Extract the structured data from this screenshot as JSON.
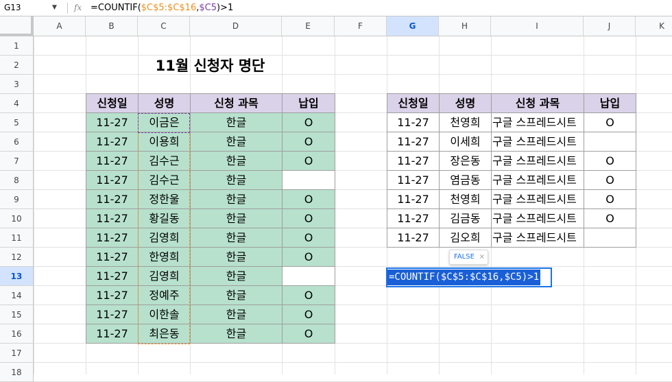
{
  "formula_bar": {
    "cell_ref": "G13",
    "fx_label": "fx",
    "formula_tokens": [
      {
        "text": "=COUNTIF(",
        "kind": "plain"
      },
      {
        "text": "$C$5:$C$16",
        "kind": "range"
      },
      {
        "text": ",",
        "kind": "plain"
      },
      {
        "text": "$C5",
        "kind": "ref"
      },
      {
        "text": ")>1",
        "kind": "plain"
      }
    ]
  },
  "grid": {
    "columns": [
      "A",
      "B",
      "C",
      "D",
      "E",
      "F",
      "G",
      "H",
      "I",
      "J",
      "K"
    ],
    "rows": [
      "1",
      "2",
      "3",
      "4",
      "5",
      "6",
      "7",
      "8",
      "9",
      "10",
      "11",
      "12",
      "13",
      "14",
      "15",
      "16",
      "17",
      "18"
    ],
    "selected_column": "G",
    "selected_row": "13"
  },
  "title": "11월 신청자 명단",
  "left_table": {
    "headers": [
      "신청일",
      "성명",
      "신청 과목",
      "납입"
    ],
    "rows": [
      [
        "11-27",
        "이금은",
        "한글",
        "O"
      ],
      [
        "11-27",
        "이용희",
        "한글",
        "O"
      ],
      [
        "11-27",
        "김수근",
        "한글",
        "O"
      ],
      [
        "11-27",
        "김수근",
        "한글",
        ""
      ],
      [
        "11-27",
        "정한울",
        "한글",
        "O"
      ],
      [
        "11-27",
        "황길동",
        "한글",
        "O"
      ],
      [
        "11-27",
        "김영희",
        "한글",
        "O"
      ],
      [
        "11-27",
        "한영희",
        "한글",
        "O"
      ],
      [
        "11-27",
        "김영희",
        "한글",
        ""
      ],
      [
        "11-27",
        "정예주",
        "한글",
        "O"
      ],
      [
        "11-27",
        "이한솔",
        "한글",
        "O"
      ],
      [
        "11-27",
        "최은동",
        "한글",
        "O"
      ]
    ]
  },
  "right_table": {
    "headers": [
      "신청일",
      "성명",
      "신청 과목",
      "납입"
    ],
    "rows": [
      [
        "11-27",
        "천영희",
        "구글 스프레드시트",
        "O"
      ],
      [
        "11-27",
        "이세희",
        "구글 스프레드시트",
        ""
      ],
      [
        "11-27",
        "장은동",
        "구글 스프레드시트",
        "O"
      ],
      [
        "11-27",
        "염금동",
        "구글 스프레드시트",
        "O"
      ],
      [
        "11-27",
        "천영희",
        "구글 스프레드시트",
        "O"
      ],
      [
        "11-27",
        "김금동",
        "구글 스프레드시트",
        "O"
      ],
      [
        "11-27",
        "김오희",
        "구글 스프레드시트",
        ""
      ]
    ]
  },
  "editor": {
    "text": "=COUNTIF($C$5:$C$16,$C5)>1",
    "preview_value": "FALSE",
    "preview_close": "×"
  },
  "colors": {
    "header_fill": "#d9d2e9",
    "body_fill": "#b7e1cd",
    "selection_blue": "#1a73e8",
    "range_orange": "#e8901f",
    "ref_purple": "#7a3ea8"
  }
}
